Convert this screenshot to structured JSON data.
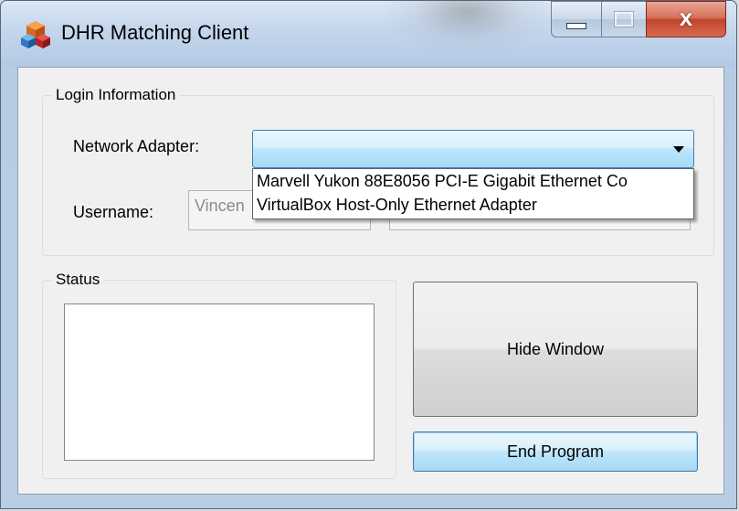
{
  "window": {
    "title": "DHR Matching Client",
    "controls": {
      "minimize": "minimize",
      "maximize": "maximize",
      "close": "x"
    }
  },
  "login": {
    "group_title": "Login Information",
    "network_adapter_label": "Network Adapter:",
    "network_adapter_value": "",
    "adapter_options": [
      "Marvell Yukon 88E8056 PCI-E Gigabit Ethernet Co",
      "VirtualBox Host-Only Ethernet Adapter"
    ],
    "username_label": "Username:",
    "username_value": "Vincen",
    "second_field_value": ""
  },
  "status": {
    "group_title": "Status"
  },
  "buttons": {
    "hide_window": "Hide Window",
    "end_program": "End Program"
  },
  "icons": {
    "app": "app-cubes-icon",
    "dropdown": "chevron-down-icon"
  }
}
